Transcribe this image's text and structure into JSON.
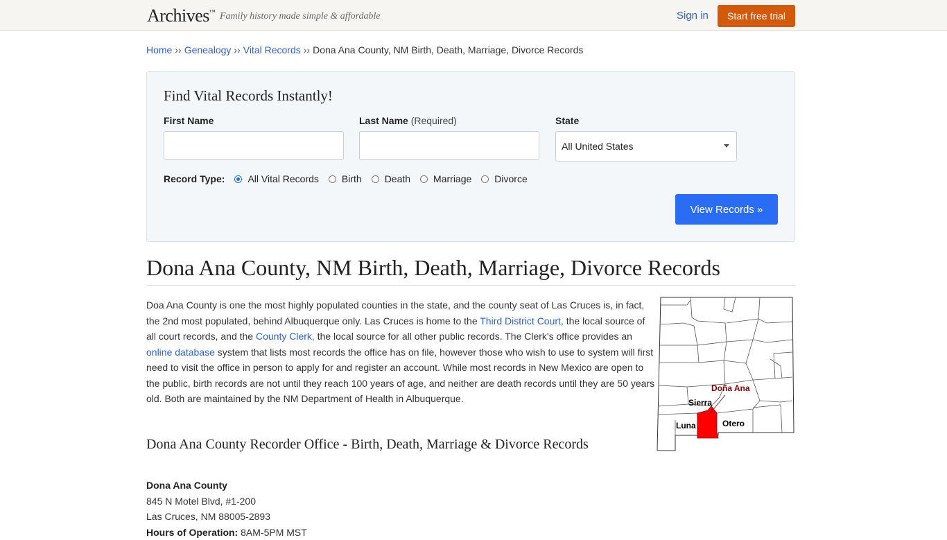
{
  "header": {
    "logo": "Archives",
    "logo_tm": "™",
    "tagline": "Family history made simple & affordable",
    "signin": "Sign in",
    "trial": "Start free trial"
  },
  "breadcrumb": {
    "items": [
      "Home",
      "Genealogy",
      "Vital Records"
    ],
    "separator": "››",
    "current": "Dona Ana County, NM Birth, Death, Marriage, Divorce Records"
  },
  "search": {
    "title": "Find Vital Records Instantly!",
    "first_name_label": "First Name",
    "last_name_label": "Last Name",
    "last_name_required": "(Required)",
    "state_label": "State",
    "first_name_value": "",
    "last_name_value": "",
    "state_value": "All United States",
    "record_type_label": "Record Type:",
    "record_types": [
      "All Vital Records",
      "Birth",
      "Death",
      "Marriage",
      "Divorce"
    ],
    "selected_record_type": "All Vital Records",
    "submit": "View Records »"
  },
  "page": {
    "title": "Dona Ana County, NM Birth, Death, Marriage, Divorce Records",
    "intro": {
      "p1": "Doa Ana County is one the most highly populated counties in the state, and the county seat of Las Cruces is, in fact, the 2nd most populated, behind Albuquerque only. Las Cruces is home to the ",
      "link1": "Third District Court,",
      "p2": " the local source of all court records, and the ",
      "link2": "County Clerk,",
      "p3": " the local source for all other public records. The Clerk's office provides an ",
      "link3": "online database",
      "p4": " system that lists most records the office has on file, however those who wish to use to system will first need to visit the office in person to apply for and register an account. While most records in New Mexico are open to the public, birth records are not until they reach 100 years of age, and neither are death records until they are 50 years old. Both are maintained by the NM Department of Health in Albuquerque."
    },
    "map_labels": {
      "dona_ana": "Doña Ana",
      "sierra": "Sierra",
      "luna": "Luna",
      "otero": "Otero"
    },
    "highlight_color": "#ff0000",
    "label_color": "#8b0000",
    "subheading": "Dona Ana County Recorder Office - Birth, Death, Marriage & Divorce Records",
    "office": {
      "name": "Dona Ana County",
      "address1": "845 N Motel Blvd, #1-200",
      "address2": "Las Cruces, NM 88005-2893",
      "hours_label": "Hours of Operation:",
      "hours": "8AM-5PM MST"
    }
  }
}
